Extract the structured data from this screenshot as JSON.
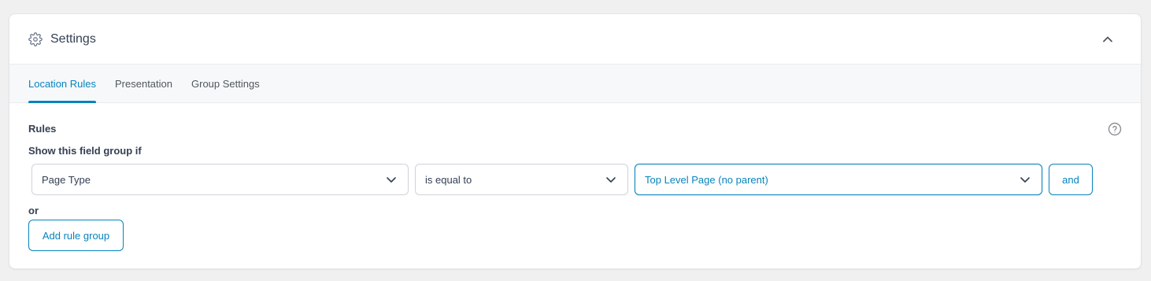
{
  "panel": {
    "title": "Settings",
    "icon": "gear-icon",
    "collapse_icon": "chevron-up-icon"
  },
  "tabs": [
    {
      "label": "Location Rules",
      "active": true
    },
    {
      "label": "Presentation",
      "active": false
    },
    {
      "label": "Group Settings",
      "active": false
    }
  ],
  "rules": {
    "heading": "Rules",
    "help_icon": "help-circle-icon",
    "condition_label": "Show this field group if",
    "rule": {
      "param": "Page Type",
      "operator": "is equal to",
      "value": "Top Level Page (no parent)",
      "and_label": "and"
    },
    "or_label": "or",
    "add_group_label": "Add rule group"
  },
  "colors": {
    "accent": "#0783be",
    "background": "#f0f0f1",
    "tab_bar": "#f7f8fa",
    "text": "#344054"
  }
}
